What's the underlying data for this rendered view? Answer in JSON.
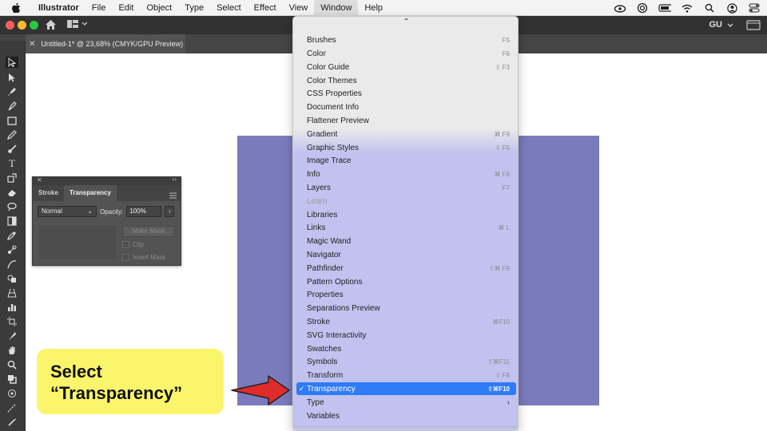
{
  "menubar": {
    "app_name": "Illustrator",
    "items": [
      "File",
      "Edit",
      "Object",
      "Type",
      "Select",
      "Effect",
      "View",
      "Window",
      "Help"
    ],
    "active_item": "Window"
  },
  "appbar": {
    "user_initials": "GU"
  },
  "document": {
    "tab_title": "Untitled-1* @ 23,68% (CMYK/GPU Preview)"
  },
  "colors": {
    "artboard": "#7a7bbd",
    "menu_highlight": "#2f7bf5",
    "callout": "#fbf56b",
    "arrow": "#e02b2b"
  },
  "panel": {
    "tabs": [
      "Stroke",
      "Transparency"
    ],
    "blend_mode": "Normal",
    "opacity_label": "Opacity:",
    "opacity_value": "100%",
    "make_mask": "Make Mask",
    "clip": "Clip",
    "invert_mask": "Invert Mask"
  },
  "menu": {
    "items": [
      {
        "label": "Brushes",
        "shortcut": "F5"
      },
      {
        "label": "Color",
        "shortcut": "F6"
      },
      {
        "label": "Color Guide",
        "shortcut": "⇧ F3"
      },
      {
        "label": "Color Themes",
        "shortcut": ""
      },
      {
        "label": "CSS Properties",
        "shortcut": ""
      },
      {
        "label": "Document Info",
        "shortcut": ""
      },
      {
        "label": "Flattener Preview",
        "shortcut": ""
      },
      {
        "label": "Gradient",
        "shortcut": "⌘ F9"
      },
      {
        "label": "Graphic Styles",
        "shortcut": "⇧ F5"
      },
      {
        "label": "Image Trace",
        "shortcut": ""
      },
      {
        "label": "Info",
        "shortcut": "⌘ F8"
      },
      {
        "label": "Layers",
        "shortcut": "F7"
      },
      {
        "label": "Learn",
        "shortcut": ""
      },
      {
        "label": "Libraries",
        "shortcut": ""
      },
      {
        "label": "Links",
        "shortcut": "⌘ L"
      },
      {
        "label": "Magic Wand",
        "shortcut": ""
      },
      {
        "label": "Navigator",
        "shortcut": ""
      },
      {
        "label": "Pathfinder",
        "shortcut": "⇧⌘ F9"
      },
      {
        "label": "Pattern Options",
        "shortcut": ""
      },
      {
        "label": "Properties",
        "shortcut": ""
      },
      {
        "label": "Separations Preview",
        "shortcut": ""
      },
      {
        "label": "Stroke",
        "shortcut": "⌘F10"
      },
      {
        "label": "SVG Interactivity",
        "shortcut": ""
      },
      {
        "label": "Swatches",
        "shortcut": ""
      },
      {
        "label": "Symbols",
        "shortcut": "⇧⌘F11"
      },
      {
        "label": "Transform",
        "shortcut": "⇧ F8"
      },
      {
        "label": "Transparency",
        "shortcut": "⇧⌘F10"
      },
      {
        "label": "Type",
        "shortcut": ""
      },
      {
        "label": "Variables",
        "shortcut": ""
      }
    ]
  },
  "callout": {
    "line1": "Select",
    "line2": "“Transparency”"
  }
}
